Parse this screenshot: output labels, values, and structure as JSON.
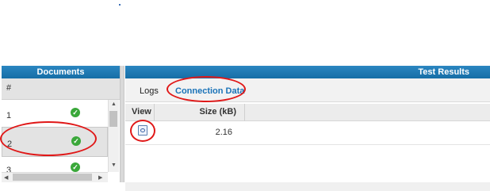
{
  "documents": {
    "title": "Documents",
    "column_header": "#",
    "rows": [
      {
        "num": "1",
        "status": "ok"
      },
      {
        "num": "2",
        "status": "ok",
        "selected": true
      },
      {
        "num": "3",
        "status": "ok"
      }
    ]
  },
  "test_results": {
    "title": "Test Results",
    "tabs": [
      {
        "label": "Logs"
      },
      {
        "label": "Connection Data",
        "active": true
      }
    ],
    "columns": {
      "view": "View",
      "size": "Size (kB)"
    },
    "rows": [
      {
        "size": "2.16",
        "icon": "view-document-icon"
      }
    ]
  },
  "colors": {
    "header_blue": "#1f7bb6",
    "active_tab": "#1a73b8",
    "status_ok": "#3aa83a",
    "annotation_red": "#e01818"
  },
  "icons": {
    "status": "check-circle-icon",
    "view": "view-document-icon"
  }
}
